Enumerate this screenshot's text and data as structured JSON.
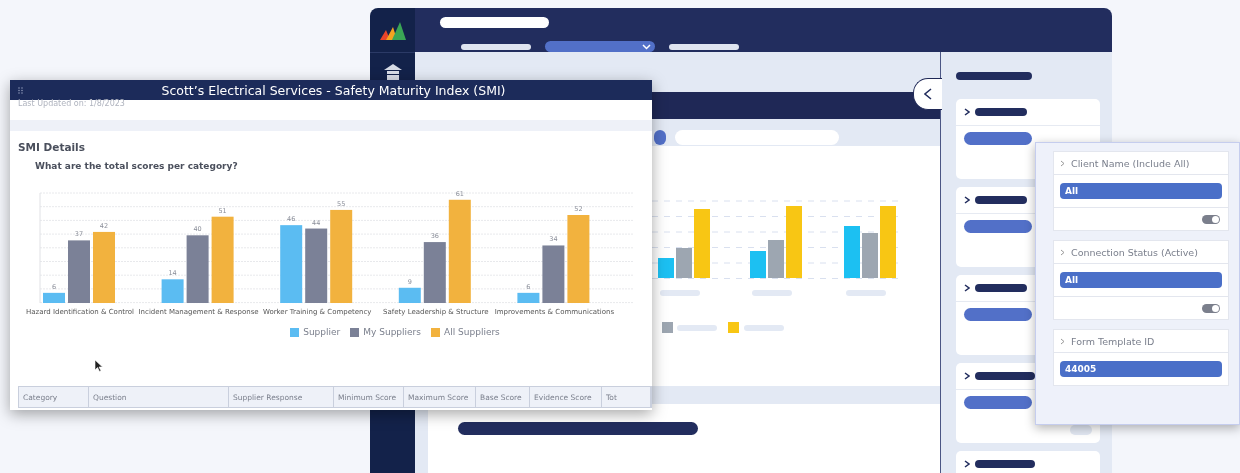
{
  "report": {
    "title": "Scott’s Electrical Services - Safety Maturity Index (SMI)",
    "updated": "Last Updated on: 1/8/2023",
    "section": "SMI Details",
    "question": "What are the total scores per category?",
    "chart_data": {
      "type": "bar",
      "categories": [
        "Hazard Identification & Control",
        "Incident Management & Response",
        "Worker Training & Competency",
        "Safety Leadership & Structure",
        "Improvements & Communications"
      ],
      "data_labels": true,
      "ylim": [
        0,
        65
      ],
      "series": [
        {
          "name": "Supplier",
          "color": "#5bbcf2",
          "values": [
            6,
            14,
            46,
            9,
            6
          ]
        },
        {
          "name": "My Suppliers",
          "color": "#7b8197",
          "values": [
            37,
            40,
            44,
            36,
            34
          ]
        },
        {
          "name": "All Suppliers",
          "color": "#f2b23e",
          "values": [
            42,
            51,
            55,
            61,
            52
          ]
        }
      ]
    },
    "columns": [
      "Category",
      "Question",
      "Supplier Response",
      "Minimum Score",
      "Maximum Score",
      "Base Score",
      "Evidence Score",
      "Tot"
    ]
  },
  "filters": [
    {
      "label": "Client Name (Include All)",
      "value": "All",
      "on": true
    },
    {
      "label": "Connection Status (Active)",
      "value": "All",
      "on": true
    },
    {
      "label": "Form Template ID",
      "value": "44005"
    }
  ]
}
